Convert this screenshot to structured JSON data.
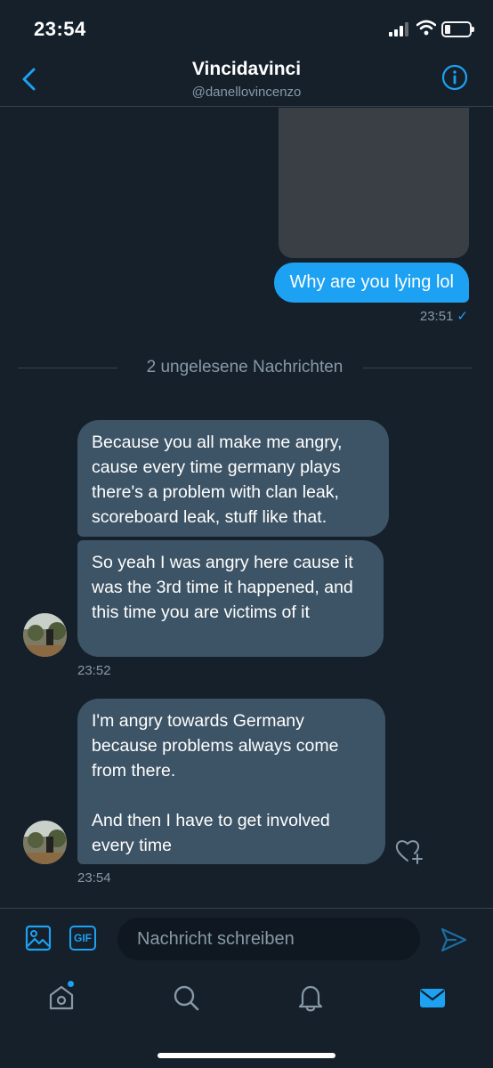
{
  "status_bar": {
    "time": "23:54",
    "icons": [
      "signal-icon",
      "wifi-icon",
      "battery-icon"
    ]
  },
  "header": {
    "name": "Vincidavinci",
    "handle": "@danellovincenzo",
    "back_icon": "chevron-left-icon",
    "info_icon": "info-circle-icon"
  },
  "messages": {
    "outgoing": {
      "text": "Why are you lying lol",
      "time": "23:51",
      "status_icon": "check-icon"
    },
    "unread_divider": "2 ungelesene Nachrichten",
    "incoming": [
      {
        "text": "Because you all make me angry, cause every time germany plays there's a problem with clan leak, scoreboard leak, stuff like that."
      },
      {
        "text": "So yeah I was angry here cause it was the 3rd time it happened, and this time you are victims of it",
        "time": "23:52"
      },
      {
        "text": "I'm angry towards Germany because problems always come from there.\n\nAnd then I have to get involved every time",
        "time": "23:54"
      }
    ]
  },
  "composer": {
    "placeholder": "Nachricht schreiben",
    "gif_label": "GIF"
  },
  "colors": {
    "background": "#15202b",
    "accent": "#1da1f2",
    "incoming_bubble": "#3d5466",
    "muted_text": "#8899a6"
  }
}
